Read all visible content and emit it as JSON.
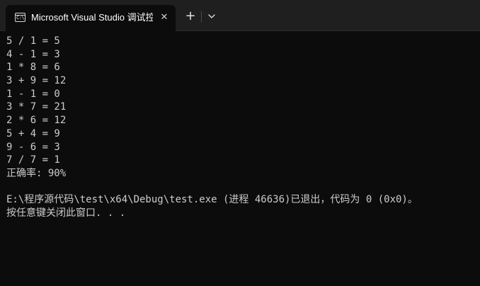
{
  "window": {
    "tab_icon_glyph": "C:\\",
    "tab_title": "Microsoft Visual Studio 调试控制台",
    "close_glyph": "✕",
    "new_tab_glyph": "+",
    "icons": {
      "tab": "console-icon",
      "close": "close-icon",
      "new_tab": "plus-icon",
      "dropdown": "chevron-down-icon"
    }
  },
  "console": {
    "text_color": "#cccccc",
    "background": "#0c0c0c",
    "lines": [
      "5 / 1 = 5",
      "4 - 1 = 3",
      "1 * 8 = 6",
      "3 + 9 = 12",
      "1 - 1 = 0",
      "3 * 7 = 21",
      "2 * 6 = 12",
      "5 + 4 = 9",
      "9 - 6 = 3",
      "7 / 7 = 1",
      "正确率: 90%",
      "",
      "E:\\程序源代码\\test\\x64\\Debug\\test.exe (进程 46636)已退出，代码为 0 (0x0)。",
      "按任意键关闭此窗口. . ."
    ]
  }
}
